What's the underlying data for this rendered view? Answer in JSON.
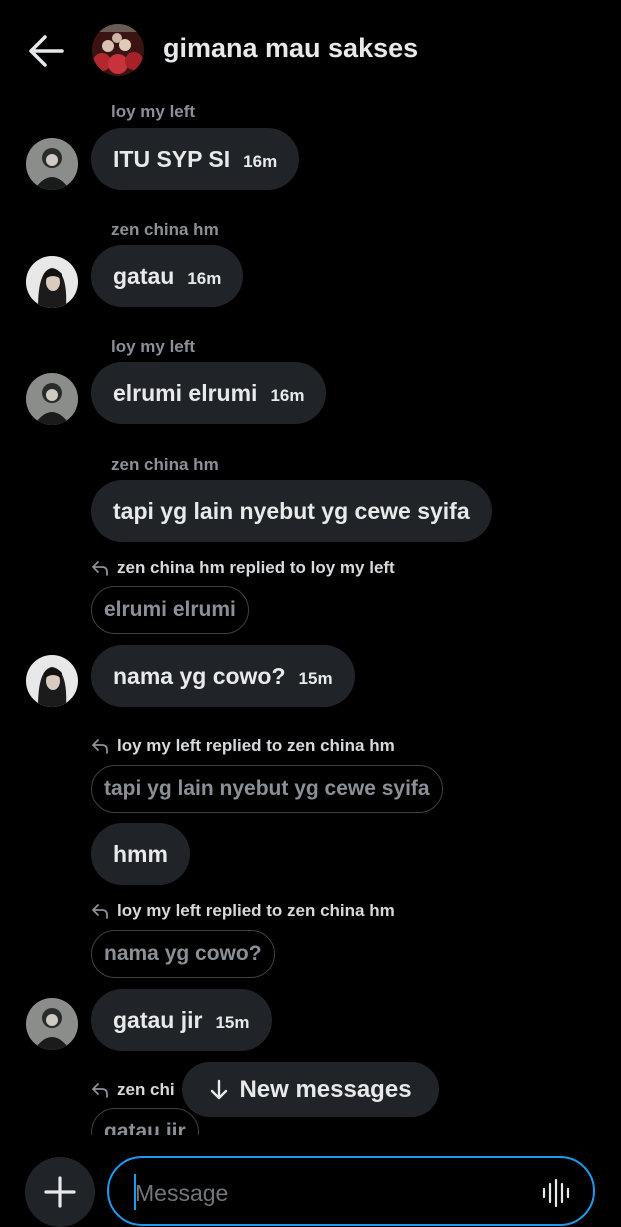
{
  "header": {
    "title": "gimana mau sakses",
    "back_icon": "arrow-left-icon"
  },
  "messages": [
    {
      "sender": "loy my left",
      "text": "ITU SYP SI",
      "time": "16m"
    },
    {
      "sender": "zen china hm",
      "text": "gatau",
      "time": "16m"
    },
    {
      "sender": "loy my left",
      "text": "elrumi elrumi",
      "time": "16m"
    },
    {
      "sender": "zen china hm",
      "text": "tapi yg lain nyebut yg cewe syifa"
    },
    {
      "reply_label": "zen china hm replied to loy my left",
      "quote": "elrumi elrumi",
      "text": "nama yg cowo?",
      "time": "15m"
    },
    {
      "reply_label": "loy my left replied to zen china hm",
      "quote": "tapi yg lain nyebut yg cewe syifa",
      "text": "hmm"
    },
    {
      "reply_label": "loy my left replied to zen china hm",
      "quote": "nama yg cowo?",
      "text": "gatau jir",
      "time": "15m"
    },
    {
      "reply_label": "zen chi",
      "quote": "gatau jir"
    }
  ],
  "new_messages_label": "New messages",
  "composer": {
    "placeholder": "Message"
  },
  "colors": {
    "accent": "#1d9bf0",
    "bubble": "#202327",
    "background": "#000000"
  }
}
